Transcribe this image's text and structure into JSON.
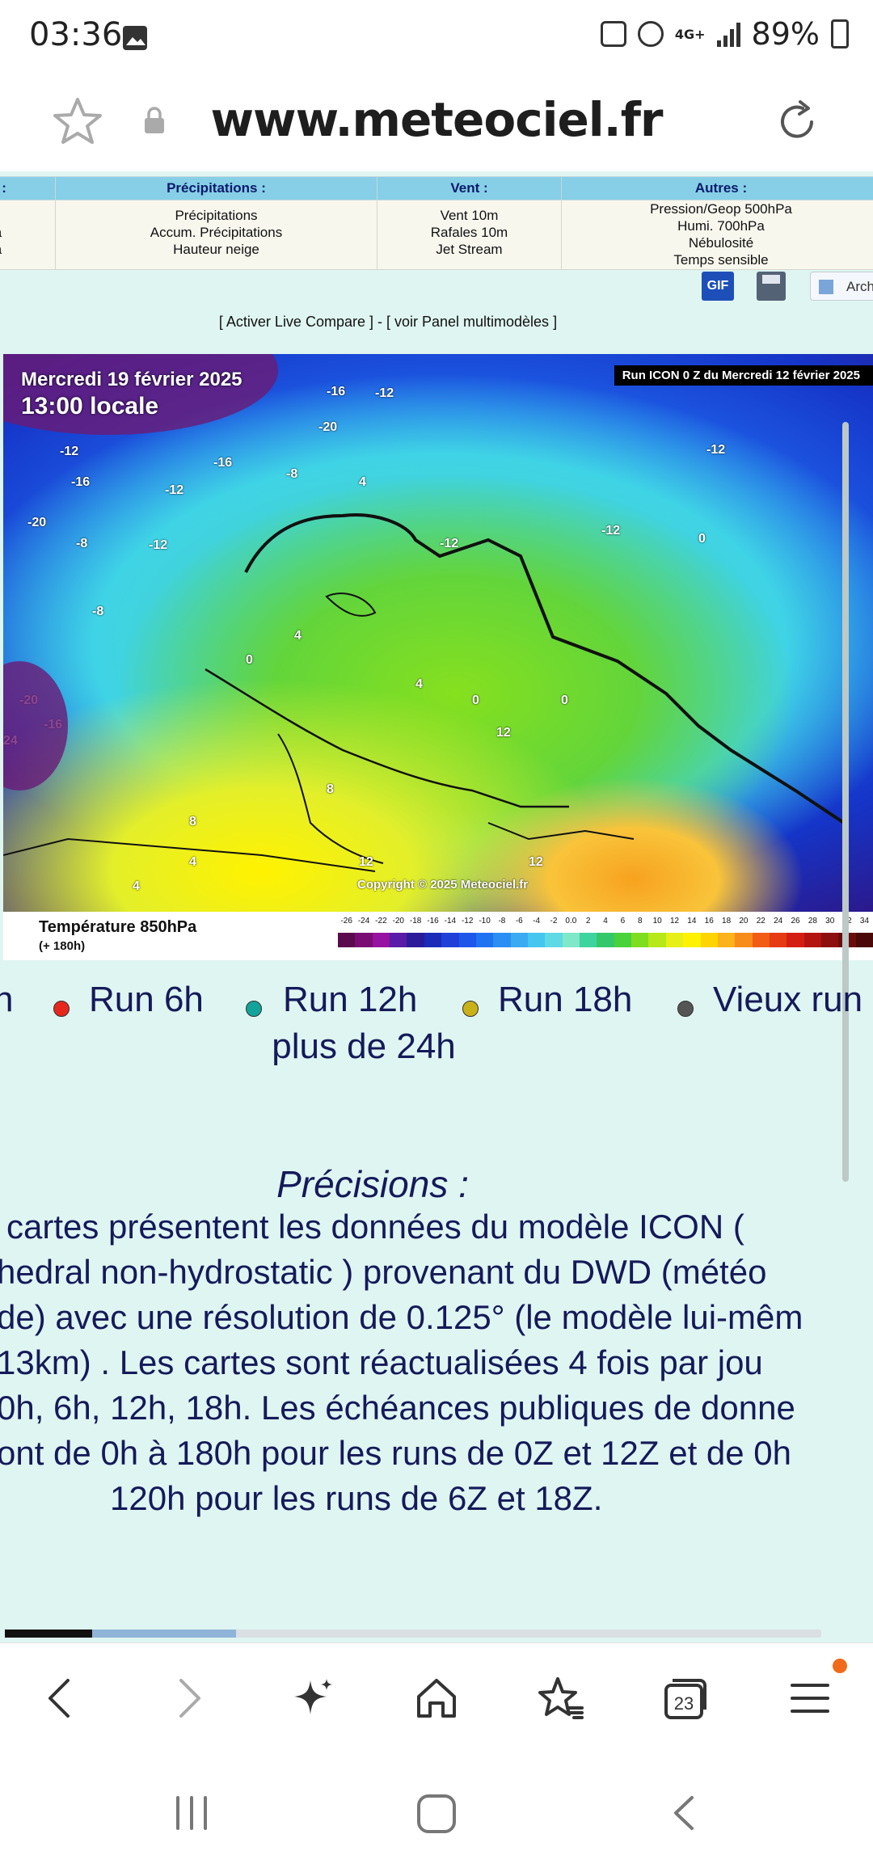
{
  "status_bar": {
    "time": "03:36",
    "network": "4G+",
    "battery": "89%",
    "icons": [
      "gallery-icon",
      "battery-saver-icon",
      "alarm-icon",
      "data-arrows-icon",
      "signal-icon",
      "battery-icon"
    ]
  },
  "browser": {
    "url": "www.meteociel.fr",
    "icons": [
      "star-icon",
      "lock-icon",
      "reload-icon"
    ]
  },
  "menu": {
    "columns": [
      {
        "header": "res :",
        "items": [
          "n",
          "hPa",
          "hPa"
        ]
      },
      {
        "header": "Précipitations :",
        "items": [
          "Précipitations",
          "Accum. Précipitations",
          "Hauteur neige"
        ]
      },
      {
        "header": "Vent :",
        "items": [
          "Vent 10m",
          "Rafales 10m",
          "Jet Stream"
        ]
      },
      {
        "header": "Autres :",
        "items": [
          "Pression/Geop 500hPa",
          "Humi. 700hPa",
          "Nébulosité",
          "Temps sensible"
        ]
      }
    ]
  },
  "tools": {
    "gif_label": "GIF",
    "archive_label": "Arch"
  },
  "compare_links": "[ Activer Live Compare ] - [ voir Panel multimodèles ]",
  "map": {
    "date": "Mercredi 19 février 2025",
    "time": "13:00 locale",
    "run_label": "Run ICON 0 Z du Mercredi 12 février 2025",
    "copyright": "Copyright © 2025 Meteociel.fr",
    "variable": "Température 850hPa",
    "step": "(+ 180h)",
    "scale_labels": [
      "-26",
      "-24",
      "-22",
      "-20",
      "-18",
      "-16",
      "-14",
      "-12",
      "-10",
      "-8",
      "-6",
      "-4",
      "-2",
      "0.0",
      "2",
      "4",
      "6",
      "8",
      "10",
      "12",
      "14",
      "16",
      "18",
      "20",
      "22",
      "24",
      "26",
      "28",
      "30",
      "32",
      "34"
    ],
    "scale_colors": [
      "#5b0a4d",
      "#7a0d73",
      "#9612a0",
      "#5a1aa8",
      "#2b1a9a",
      "#1c2ab8",
      "#1e40d8",
      "#1e56ea",
      "#1f73f0",
      "#2a8ef2",
      "#3aaaf2",
      "#45c6f0",
      "#5fd9e4",
      "#7ee8c8",
      "#3fd3a0",
      "#35c86a",
      "#4ad23a",
      "#7fdd20",
      "#b6e81a",
      "#e6ef18",
      "#fff200",
      "#ffd400",
      "#fcb21a",
      "#f78c1a",
      "#f25c14",
      "#e53a12",
      "#d41e12",
      "#b41410",
      "#8e100e",
      "#6a0c0c",
      "#4a0808"
    ],
    "contour_labels": [
      "-12",
      "-16",
      "-20",
      "-8",
      "-12",
      "-16",
      "-8",
      "-20",
      "-16",
      "-12",
      "-12",
      "-12",
      "0",
      "4",
      "-8",
      "-12",
      "-12",
      "4",
      "0",
      "4",
      "0",
      "0",
      "-20",
      "-16",
      "24",
      "8",
      "4",
      "4",
      "12",
      "12",
      "12",
      "8",
      "4"
    ]
  },
  "runs": {
    "items": [
      {
        "label": "h",
        "color": ""
      },
      {
        "label": "Run 6h",
        "color": "#e5271e"
      },
      {
        "label": "Run 12h",
        "color": "#12a39a"
      },
      {
        "label": "Run 18h",
        "color": "#c9b218"
      },
      {
        "label": "Vieux run",
        "color": "#555555"
      }
    ],
    "line2": "plus de 24h"
  },
  "precisions": {
    "title": "Précisions :",
    "lines": [
      "cartes présentent les données du modèle ICON (",
      "hedral non-hydrostatic ) provenant du DWD (météo",
      "de) avec une résolution de 0.125° (le modèle lui-mêm",
      "13km) . Les cartes sont réactualisées 4 fois par jou",
      "0h, 6h, 12h, 18h. Les échéances publiques de donne",
      "ont de 0h à 180h pour les runs de 0Z et 12Z et de 0h",
      "120h pour les runs de 6Z et 18Z."
    ]
  },
  "toolbar": {
    "tabs_count": "23",
    "icons": [
      "back-icon",
      "forward-icon",
      "ai-sparkle-icon",
      "home-icon",
      "bookmarks-icon",
      "tabs-icon",
      "menu-icon"
    ]
  },
  "navbar": {
    "icons": [
      "recent-apps-icon",
      "home-nav-icon",
      "back-nav-icon"
    ]
  }
}
